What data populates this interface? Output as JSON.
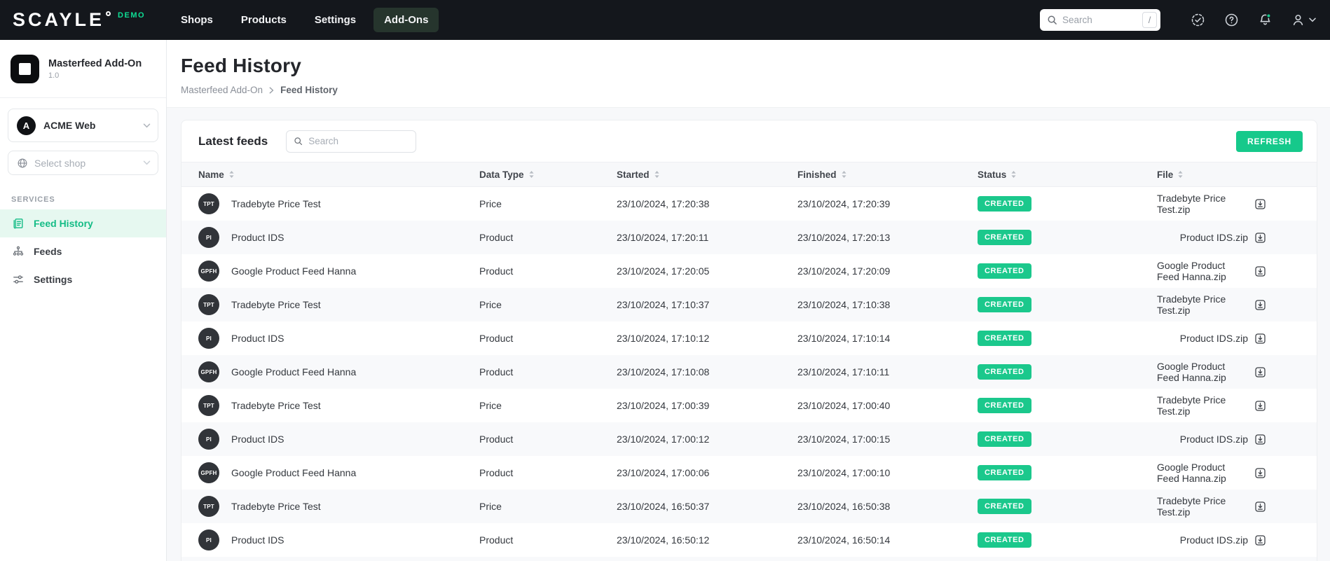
{
  "colors": {
    "accent": "#16C98B",
    "demo_green": "#0EDD94",
    "topbar_bg": "#14171C",
    "active_nav_bg": "#26352D",
    "sidebar_active_bg": "#E6F8F0",
    "sidebar_active_text": "#14BC86",
    "status_created_bg": "#1BC88C"
  },
  "topbar": {
    "logo_text": "SCAYLE",
    "env_badge": "DEMO",
    "nav_items": [
      {
        "label": "Shops",
        "active": false
      },
      {
        "label": "Products",
        "active": false
      },
      {
        "label": "Settings",
        "active": false
      },
      {
        "label": "Add-Ons",
        "active": true
      }
    ],
    "search": {
      "placeholder": "Search",
      "shortcut_key": "/"
    },
    "icons": [
      "activity-check-icon",
      "help-icon",
      "notifications-bell-icon",
      "account-user-icon"
    ],
    "notifications_unread": true
  },
  "sidebar": {
    "app_name": "Masterfeed Add-On",
    "app_version": "1.0",
    "company_selector": {
      "name": "ACME Web",
      "initial": "A"
    },
    "shop_selector": {
      "placeholder": "Select shop"
    },
    "section_label": "SERVICES",
    "items": [
      {
        "label": "Feed History",
        "icon": "feed-history-icon",
        "active": true
      },
      {
        "label": "Feeds",
        "icon": "feeds-sitemap-icon",
        "active": false
      },
      {
        "label": "Settings",
        "icon": "settings-sliders-icon",
        "active": false
      }
    ]
  },
  "page": {
    "title": "Feed History",
    "breadcrumb": [
      "Masterfeed Add-On",
      "Feed History"
    ]
  },
  "card": {
    "title": "Latest feeds",
    "search_placeholder": "Search",
    "refresh_button": "REFRESH"
  },
  "table": {
    "columns": [
      "Name",
      "Data Type",
      "Started",
      "Finished",
      "Status",
      "File"
    ],
    "rows": [
      {
        "initials": "TPT",
        "name": "Tradebyte Price Test",
        "data_type": "Price",
        "started": "23/10/2024, 17:20:38",
        "finished": "23/10/2024, 17:20:39",
        "status": "CREATED",
        "file": "Tradebyte Price Test.zip"
      },
      {
        "initials": "PI",
        "name": "Product IDS",
        "data_type": "Product",
        "started": "23/10/2024, 17:20:11",
        "finished": "23/10/2024, 17:20:13",
        "status": "CREATED",
        "file": "Product IDS.zip"
      },
      {
        "initials": "GPFH",
        "name": "Google Product Feed Hanna",
        "data_type": "Product",
        "started": "23/10/2024, 17:20:05",
        "finished": "23/10/2024, 17:20:09",
        "status": "CREATED",
        "file": "Google Product Feed Hanna.zip"
      },
      {
        "initials": "TPT",
        "name": "Tradebyte Price Test",
        "data_type": "Price",
        "started": "23/10/2024, 17:10:37",
        "finished": "23/10/2024, 17:10:38",
        "status": "CREATED",
        "file": "Tradebyte Price Test.zip"
      },
      {
        "initials": "PI",
        "name": "Product IDS",
        "data_type": "Product",
        "started": "23/10/2024, 17:10:12",
        "finished": "23/10/2024, 17:10:14",
        "status": "CREATED",
        "file": "Product IDS.zip"
      },
      {
        "initials": "GPFH",
        "name": "Google Product Feed Hanna",
        "data_type": "Product",
        "started": "23/10/2024, 17:10:08",
        "finished": "23/10/2024, 17:10:11",
        "status": "CREATED",
        "file": "Google Product Feed Hanna.zip"
      },
      {
        "initials": "TPT",
        "name": "Tradebyte Price Test",
        "data_type": "Price",
        "started": "23/10/2024, 17:00:39",
        "finished": "23/10/2024, 17:00:40",
        "status": "CREATED",
        "file": "Tradebyte Price Test.zip"
      },
      {
        "initials": "PI",
        "name": "Product IDS",
        "data_type": "Product",
        "started": "23/10/2024, 17:00:12",
        "finished": "23/10/2024, 17:00:15",
        "status": "CREATED",
        "file": "Product IDS.zip"
      },
      {
        "initials": "GPFH",
        "name": "Google Product Feed Hanna",
        "data_type": "Product",
        "started": "23/10/2024, 17:00:06",
        "finished": "23/10/2024, 17:00:10",
        "status": "CREATED",
        "file": "Google Product Feed Hanna.zip"
      },
      {
        "initials": "TPT",
        "name": "Tradebyte Price Test",
        "data_type": "Price",
        "started": "23/10/2024, 16:50:37",
        "finished": "23/10/2024, 16:50:38",
        "status": "CREATED",
        "file": "Tradebyte Price Test.zip"
      },
      {
        "initials": "PI",
        "name": "Product IDS",
        "data_type": "Product",
        "started": "23/10/2024, 16:50:12",
        "finished": "23/10/2024, 16:50:14",
        "status": "CREATED",
        "file": "Product IDS.zip"
      }
    ]
  }
}
